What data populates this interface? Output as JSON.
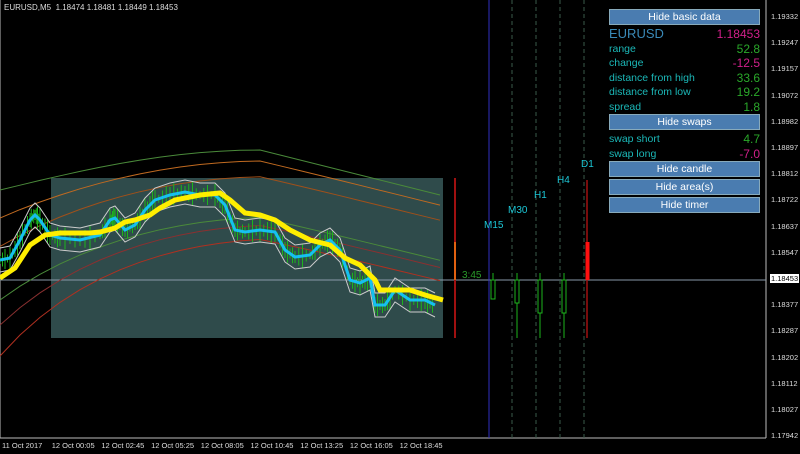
{
  "title": "EURUSD,M5  1.18474 1.18481 1.18449 1.18453",
  "price_axis": [
    "1.19332",
    "1.19247",
    "1.19157",
    "1.19072",
    "1.18982",
    "1.18897",
    "1.18812",
    "1.18722",
    "1.18637",
    "1.18547",
    "1.18453",
    "1.18377",
    "1.18287",
    "1.18202",
    "1.18112",
    "1.18027",
    "1.17942"
  ],
  "current_price": "1.18453",
  "time_axis": [
    "11 Oct 2017",
    "12 Oct 00:05",
    "12 Oct 02:45",
    "12 Oct 05:25",
    "12 Oct 08:05",
    "12 Oct 10:45",
    "12 Oct 13:25",
    "12 Oct 16:05",
    "12 Oct 18:45"
  ],
  "timeframes": [
    "M15",
    "M30",
    "H1",
    "H4",
    "D1"
  ],
  "timer": "3:45",
  "panel": {
    "hide_basic": "Hide basic data",
    "symbol": "EURUSD",
    "price": "1.18453",
    "rows": [
      {
        "label": "range",
        "value": "52.8",
        "color": "#2aa82a"
      },
      {
        "label": "change",
        "value": "-12.5",
        "color": "#d0208a"
      },
      {
        "label": "distance from high",
        "value": "33.6",
        "color": "#2aa82a"
      },
      {
        "label": "distance from low",
        "value": "19.2",
        "color": "#2aa82a"
      },
      {
        "label": "spread",
        "value": "1.8",
        "color": "#2aa82a"
      }
    ],
    "hide_swaps": "Hide swaps",
    "swaps": [
      {
        "label": "swap short",
        "value": "4.7",
        "color": "#2aa82a"
      },
      {
        "label": "swap long",
        "value": "-7.0",
        "color": "#d0208a"
      }
    ],
    "hide_candle": "Hide candle",
    "hide_areas": "Hide area(s)",
    "hide_timer": "Hide timer"
  }
}
